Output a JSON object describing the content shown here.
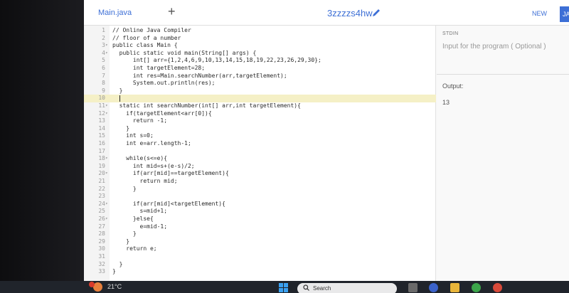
{
  "editor_tab": {
    "file": "Main.java",
    "add_label": "+"
  },
  "project": {
    "name": "3zzzzs4hw"
  },
  "header": {
    "new_label": "NEW",
    "lang_label": "JA"
  },
  "code_lines": [
    {
      "n": "1",
      "fold": "",
      "text": "// Online Java Compiler"
    },
    {
      "n": "2",
      "fold": "",
      "text": "// floor of a number"
    },
    {
      "n": "3",
      "fold": "▾",
      "text": "public class Main {"
    },
    {
      "n": "4",
      "fold": "▾",
      "text": "  public static void main(String[] args) {"
    },
    {
      "n": "5",
      "fold": "",
      "text": "      int[] arr={1,2,4,6,9,10,13,14,15,18,19,22,23,26,29,30};"
    },
    {
      "n": "6",
      "fold": "",
      "text": "      int targetElement=28;"
    },
    {
      "n": "7",
      "fold": "",
      "text": "      int res=Main.searchNumber(arr,targetElement);"
    },
    {
      "n": "8",
      "fold": "",
      "text": "      System.out.println(res);"
    },
    {
      "n": "9",
      "fold": "",
      "text": "  }"
    },
    {
      "n": "10",
      "fold": "",
      "text": ""
    },
    {
      "n": "11",
      "fold": "▾",
      "text": "  static int searchNumber(int[] arr,int targetElement){"
    },
    {
      "n": "12",
      "fold": "▾",
      "text": "    if(targetElement<arr[0]){"
    },
    {
      "n": "13",
      "fold": "",
      "text": "      return -1;"
    },
    {
      "n": "14",
      "fold": "",
      "text": "    }"
    },
    {
      "n": "15",
      "fold": "",
      "text": "    int s=0;"
    },
    {
      "n": "16",
      "fold": "",
      "text": "    int e=arr.length-1;"
    },
    {
      "n": "17",
      "fold": "",
      "text": ""
    },
    {
      "n": "18",
      "fold": "▾",
      "text": "    while(s<=e){"
    },
    {
      "n": "19",
      "fold": "",
      "text": "      int mid=s+(e-s)/2;"
    },
    {
      "n": "20",
      "fold": "▾",
      "text": "      if(arr[mid]==targetElement){"
    },
    {
      "n": "21",
      "fold": "",
      "text": "        return mid;"
    },
    {
      "n": "22",
      "fold": "",
      "text": "      }"
    },
    {
      "n": "23",
      "fold": "",
      "text": ""
    },
    {
      "n": "24",
      "fold": "▾",
      "text": "      if(arr[mid]<targetElement){"
    },
    {
      "n": "25",
      "fold": "",
      "text": "        s=mid+1;"
    },
    {
      "n": "26",
      "fold": "▾",
      "text": "      }else{"
    },
    {
      "n": "27",
      "fold": "",
      "text": "        e=mid-1;"
    },
    {
      "n": "28",
      "fold": "",
      "text": "      }"
    },
    {
      "n": "29",
      "fold": "",
      "text": "    }"
    },
    {
      "n": "30",
      "fold": "",
      "text": "    return e;"
    },
    {
      "n": "31",
      "fold": "",
      "text": ""
    },
    {
      "n": "32",
      "fold": "",
      "text": "  }"
    },
    {
      "n": "33",
      "fold": "",
      "text": "}"
    }
  ],
  "active_line": "10",
  "stdin": {
    "label": "STDIN",
    "placeholder": "Input for the program ( Optional )"
  },
  "output": {
    "label": "Output:",
    "value": "13"
  },
  "taskbar": {
    "weather": "21°C",
    "search": "Search"
  },
  "colors": {
    "accent": "#3d6fd6",
    "active_line": "#f5f0c6"
  }
}
